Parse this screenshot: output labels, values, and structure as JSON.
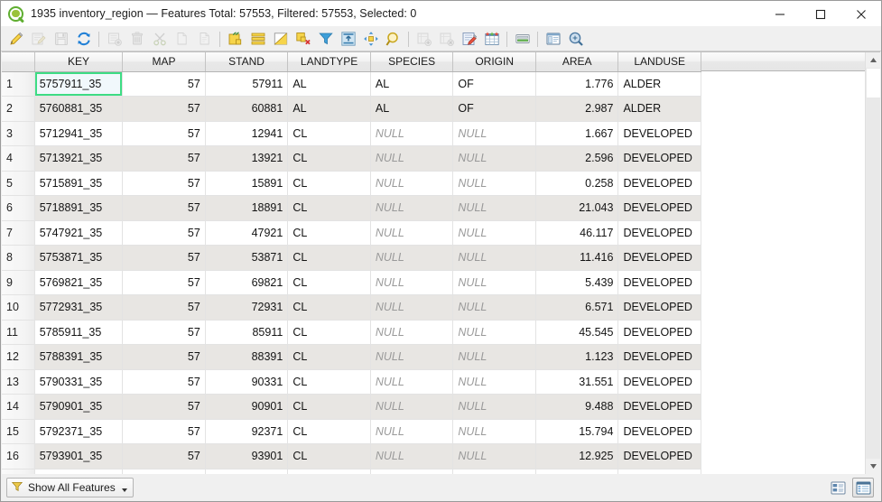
{
  "window": {
    "title": "1935 inventory_region — Features Total: 57553, Filtered: 57553, Selected: 0",
    "app_icon": "qgis-logo-icon",
    "minimize_label": "Minimize",
    "maximize_label": "Maximize",
    "close_label": "Close"
  },
  "toolbar": {
    "buttons": [
      {
        "name": "toggle-editing-icon",
        "tip": "Toggle editing mode",
        "enabled": true
      },
      {
        "name": "save-edits-pencil-icon",
        "tip": "Save edits",
        "enabled": false
      },
      {
        "name": "save-layer-edits-icon",
        "tip": "Save layer edits",
        "enabled": false
      },
      {
        "name": "reload-table-icon",
        "tip": "Reload the table",
        "enabled": true
      },
      {
        "name": "separator-1",
        "tip": "",
        "enabled": true
      },
      {
        "name": "add-feature-icon",
        "tip": "Add feature",
        "enabled": false
      },
      {
        "name": "delete-selected-icon",
        "tip": "Delete selected features",
        "enabled": false
      },
      {
        "name": "cut-features-icon",
        "tip": "Cut selected features",
        "enabled": false
      },
      {
        "name": "copy-features-icon",
        "tip": "Copy selected features",
        "enabled": false
      },
      {
        "name": "paste-features-icon",
        "tip": "Paste features",
        "enabled": false
      },
      {
        "name": "separator-2",
        "tip": "",
        "enabled": true
      },
      {
        "name": "select-by-expression-icon",
        "tip": "Select features using an expression",
        "enabled": true
      },
      {
        "name": "select-all-icon",
        "tip": "Select all features",
        "enabled": true
      },
      {
        "name": "invert-selection-icon",
        "tip": "Invert selection",
        "enabled": true
      },
      {
        "name": "deselect-all-icon",
        "tip": "Deselect all features",
        "enabled": true
      },
      {
        "name": "filter-selection-icon",
        "tip": "Filter / select features",
        "enabled": true
      },
      {
        "name": "move-selection-to-top-icon",
        "tip": "Move selection to top",
        "enabled": true
      },
      {
        "name": "pan-to-selection-icon",
        "tip": "Pan map to selected rows",
        "enabled": true
      },
      {
        "name": "zoom-to-selection-icon",
        "tip": "Zoom map to selected rows",
        "enabled": true
      },
      {
        "name": "separator-3",
        "tip": "",
        "enabled": true
      },
      {
        "name": "new-field-icon",
        "tip": "New field",
        "enabled": false
      },
      {
        "name": "delete-field-icon",
        "tip": "Delete field",
        "enabled": false
      },
      {
        "name": "open-field-calculator-icon",
        "tip": "Open field calculator",
        "enabled": true
      },
      {
        "name": "conditional-formatting-icon",
        "tip": "Conditional formatting",
        "enabled": true
      },
      {
        "name": "separator-4",
        "tip": "",
        "enabled": true
      },
      {
        "name": "organize-columns-icon",
        "tip": "Organize columns",
        "enabled": true
      },
      {
        "name": "separator-5",
        "tip": "",
        "enabled": true
      },
      {
        "name": "dock-undock-icon",
        "tip": "Dock attribute table",
        "enabled": true
      },
      {
        "name": "actions-icon",
        "tip": "Actions",
        "enabled": true
      }
    ]
  },
  "table": {
    "columns": [
      "KEY",
      "MAP",
      "STAND",
      "LANDTYPE",
      "SPECIES",
      "ORIGIN",
      "AREA",
      "LANDUSE"
    ],
    "null_text": "NULL",
    "selected_cell": {
      "row": 0,
      "col": 0
    },
    "rows": [
      {
        "n": "1",
        "KEY": "5757911_35",
        "MAP": "57",
        "STAND": "57911",
        "LANDTYPE": "AL",
        "SPECIES": "AL",
        "ORIGIN": "OF",
        "AREA": "1.776",
        "LANDUSE": "ALDER"
      },
      {
        "n": "2",
        "KEY": "5760881_35",
        "MAP": "57",
        "STAND": "60881",
        "LANDTYPE": "AL",
        "SPECIES": "AL",
        "ORIGIN": "OF",
        "AREA": "2.987",
        "LANDUSE": "ALDER"
      },
      {
        "n": "3",
        "KEY": "5712941_35",
        "MAP": "57",
        "STAND": "12941",
        "LANDTYPE": "CL",
        "SPECIES": "NULL",
        "ORIGIN": "NULL",
        "AREA": "1.667",
        "LANDUSE": "DEVELOPED"
      },
      {
        "n": "4",
        "KEY": "5713921_35",
        "MAP": "57",
        "STAND": "13921",
        "LANDTYPE": "CL",
        "SPECIES": "NULL",
        "ORIGIN": "NULL",
        "AREA": "2.596",
        "LANDUSE": "DEVELOPED"
      },
      {
        "n": "5",
        "KEY": "5715891_35",
        "MAP": "57",
        "STAND": "15891",
        "LANDTYPE": "CL",
        "SPECIES": "NULL",
        "ORIGIN": "NULL",
        "AREA": "0.258",
        "LANDUSE": "DEVELOPED"
      },
      {
        "n": "6",
        "KEY": "5718891_35",
        "MAP": "57",
        "STAND": "18891",
        "LANDTYPE": "CL",
        "SPECIES": "NULL",
        "ORIGIN": "NULL",
        "AREA": "21.043",
        "LANDUSE": "DEVELOPED"
      },
      {
        "n": "7",
        "KEY": "5747921_35",
        "MAP": "57",
        "STAND": "47921",
        "LANDTYPE": "CL",
        "SPECIES": "NULL",
        "ORIGIN": "NULL",
        "AREA": "46.117",
        "LANDUSE": "DEVELOPED"
      },
      {
        "n": "8",
        "KEY": "5753871_35",
        "MAP": "57",
        "STAND": "53871",
        "LANDTYPE": "CL",
        "SPECIES": "NULL",
        "ORIGIN": "NULL",
        "AREA": "11.416",
        "LANDUSE": "DEVELOPED"
      },
      {
        "n": "9",
        "KEY": "5769821_35",
        "MAP": "57",
        "STAND": "69821",
        "LANDTYPE": "CL",
        "SPECIES": "NULL",
        "ORIGIN": "NULL",
        "AREA": "5.439",
        "LANDUSE": "DEVELOPED"
      },
      {
        "n": "10",
        "KEY": "5772931_35",
        "MAP": "57",
        "STAND": "72931",
        "LANDTYPE": "CL",
        "SPECIES": "NULL",
        "ORIGIN": "NULL",
        "AREA": "6.571",
        "LANDUSE": "DEVELOPED"
      },
      {
        "n": "11",
        "KEY": "5785911_35",
        "MAP": "57",
        "STAND": "85911",
        "LANDTYPE": "CL",
        "SPECIES": "NULL",
        "ORIGIN": "NULL",
        "AREA": "45.545",
        "LANDUSE": "DEVELOPED"
      },
      {
        "n": "12",
        "KEY": "5788391_35",
        "MAP": "57",
        "STAND": "88391",
        "LANDTYPE": "CL",
        "SPECIES": "NULL",
        "ORIGIN": "NULL",
        "AREA": "1.123",
        "LANDUSE": "DEVELOPED"
      },
      {
        "n": "13",
        "KEY": "5790331_35",
        "MAP": "57",
        "STAND": "90331",
        "LANDTYPE": "CL",
        "SPECIES": "NULL",
        "ORIGIN": "NULL",
        "AREA": "31.551",
        "LANDUSE": "DEVELOPED"
      },
      {
        "n": "14",
        "KEY": "5790901_35",
        "MAP": "57",
        "STAND": "90901",
        "LANDTYPE": "CL",
        "SPECIES": "NULL",
        "ORIGIN": "NULL",
        "AREA": "9.488",
        "LANDUSE": "DEVELOPED"
      },
      {
        "n": "15",
        "KEY": "5792371_35",
        "MAP": "57",
        "STAND": "92371",
        "LANDTYPE": "CL",
        "SPECIES": "NULL",
        "ORIGIN": "NULL",
        "AREA": "15.794",
        "LANDUSE": "DEVELOPED"
      },
      {
        "n": "16",
        "KEY": "5793901_35",
        "MAP": "57",
        "STAND": "93901",
        "LANDTYPE": "CL",
        "SPECIES": "NULL",
        "ORIGIN": "NULL",
        "AREA": "12.925",
        "LANDUSE": "DEVELOPED"
      },
      {
        "n": "",
        "KEY": "",
        "MAP": "",
        "STAND": "",
        "LANDTYPE": "",
        "SPECIES": "",
        "ORIGIN": "",
        "AREA": "",
        "LANDUSE": ""
      }
    ]
  },
  "statusbar": {
    "show_all_label": "Show All Features",
    "filter_icon": "funnel-icon",
    "view_form_label": "Switch to form view",
    "view_table_label": "Switch to table view"
  },
  "colors": {
    "selection_outline": "#3ddc84",
    "alt_row": "#e8e6e3",
    "null_text": "#9a9a9a",
    "accent_yellow": "#f4d63c",
    "accent_green": "#5fae30"
  }
}
